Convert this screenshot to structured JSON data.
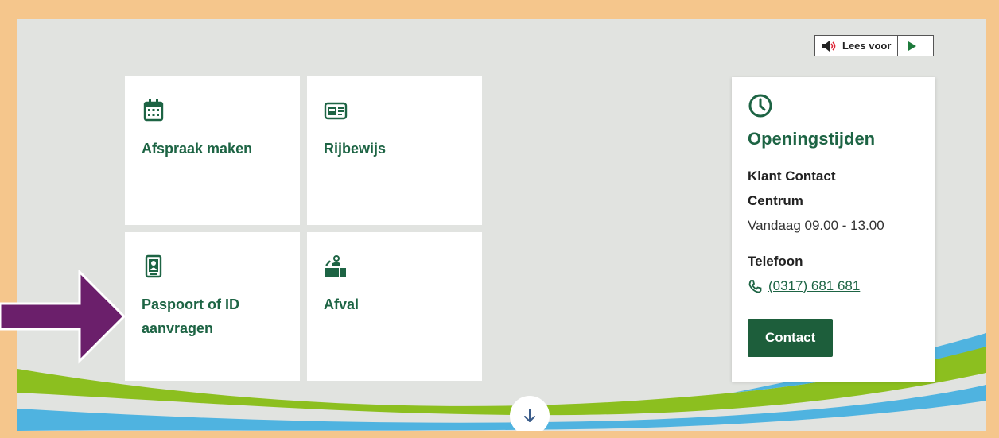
{
  "listen": {
    "label": "Lees voor"
  },
  "tiles": [
    {
      "label": "Afspraak maken"
    },
    {
      "label": "Rijbewijs"
    },
    {
      "label": "Paspoort of ID aanvragen",
      "line1": "Paspoort of ID",
      "line2": "aanvragen"
    },
    {
      "label": "Afval"
    }
  ],
  "hours": {
    "title": "Openingstijden",
    "kcc_line1": "Klant Contact",
    "kcc_line2": "Centrum",
    "today": "Vandaag 09.00 - 13.00",
    "phone_label": "Telefoon",
    "phone": "(0317) 681 681",
    "contact_button": "Contact"
  },
  "colors": {
    "accent": "#1d6444",
    "frame": "#f5c68c",
    "arrow": "#6b1f6b",
    "wave_green": "#8cbf1f",
    "wave_blue": "#4fb3e0"
  }
}
